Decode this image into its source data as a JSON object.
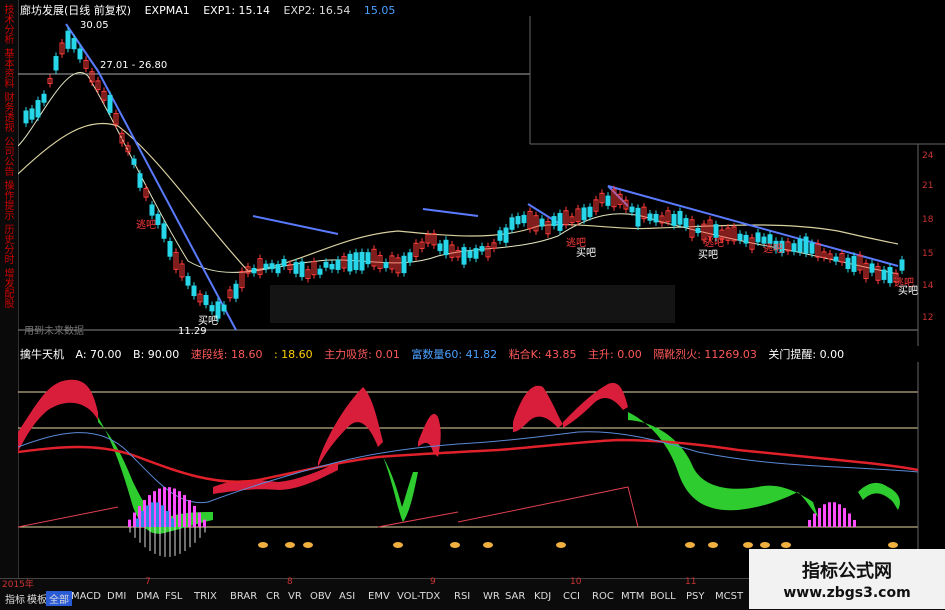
{
  "header": {
    "stock_name": "廊坊发展(日线 前复权)",
    "indicator": "EXPMA1",
    "exp1": "EXP1: 15.14",
    "exp2": "EXP2: 16.54",
    "extra": "15.05"
  },
  "price_labels": {
    "high": "30.05",
    "range": "27.01 - 26.80",
    "low": "11.29"
  },
  "annotations": {
    "buy": "买吧",
    "sell": "逃吧",
    "unused_hint": "用到未来数据"
  },
  "sub_header": {
    "name": "擒牛天机",
    "a": "A: 70.00",
    "b": "B: 90.00",
    "speed": "速段线: 18.60",
    "speed2": ": 18.60",
    "main": "主力吸货: 0.01",
    "wealth": "富数量60: 41.82",
    "margin": "粘合K: 43.85",
    "lift": "主升: 0.00",
    "flame": "隔靴烈火: 11269.03",
    "watch": "关门提醒: 0.00"
  },
  "right_axis": [
    "24",
    "21",
    "18",
    "15",
    "14",
    "12"
  ],
  "left_strip_tabs": [
    "技术分析",
    "基本资料",
    "财务透视",
    "公司公告",
    "操作提示",
    "历史分时",
    "增发配股"
  ],
  "bottom_dates": [
    "2015年",
    "7",
    "8",
    "9",
    "10",
    "11"
  ],
  "bottom_tabs": [
    "指标",
    "模板",
    "全部",
    "MACD",
    "DMI",
    "DMA",
    "FSL",
    "TRIX",
    "BRAR",
    "CR",
    "VR",
    "OBV",
    "ASI",
    "EMV",
    "VOL-TDX",
    "RSI",
    "WR",
    "SAR",
    "KDJ",
    "CCI",
    "ROC",
    "MTM",
    "BOLL",
    "PSY",
    "MCST"
  ],
  "watermark": {
    "title": "指标公式网",
    "url": "www.zbgs3.com"
  },
  "colors": {
    "up": "#ff3b3b",
    "down": "#27d6e8",
    "trend": "#5a7bff",
    "ma": "#d8d0a0",
    "green_fill": "#2ecc2e",
    "red_fill": "#d81e3a",
    "magenta": "#ff4dff"
  }
}
